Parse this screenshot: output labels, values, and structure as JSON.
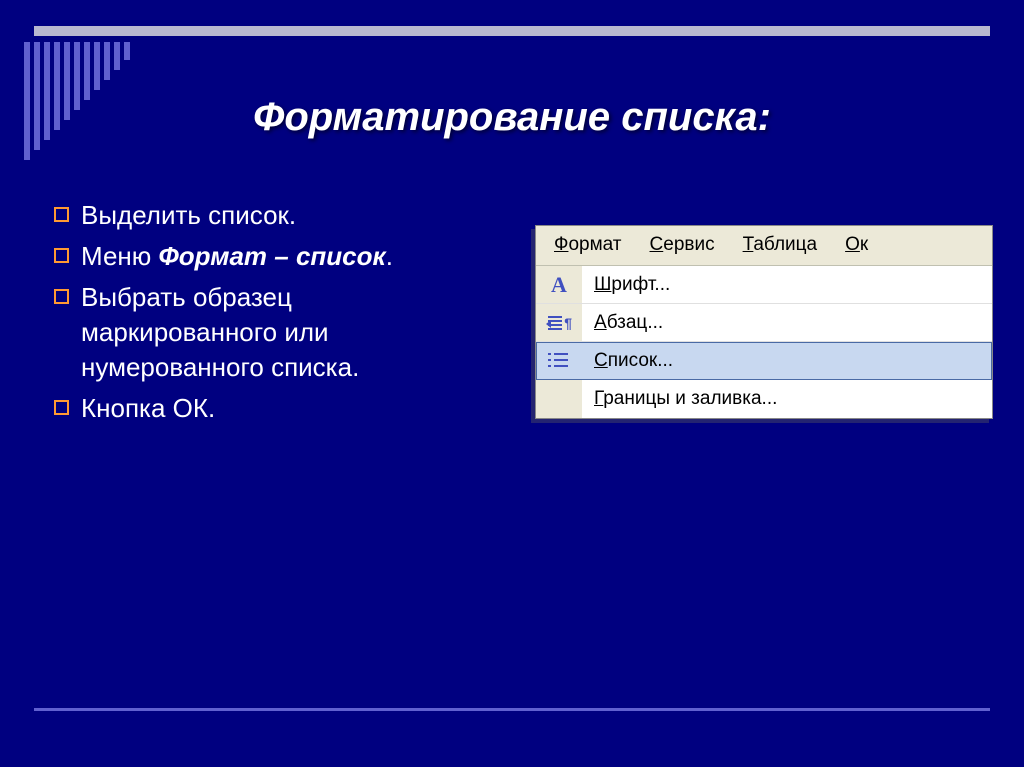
{
  "slide": {
    "title": "Форматирование списка:",
    "bullets": [
      {
        "pre": "Выделить список."
      },
      {
        "pre": "Меню ",
        "em": "Формат – список",
        "post": "."
      },
      {
        "pre": "Выбрать образец маркированного или нумерованного списка."
      },
      {
        "pre": "Кнопка ОК."
      }
    ]
  },
  "menu": {
    "bar": [
      {
        "u": "Ф",
        "rest": "ормат"
      },
      {
        "u": "С",
        "rest": "ервис"
      },
      {
        "u": "Т",
        "rest": "аблица"
      },
      {
        "u": "О",
        "rest": "к"
      }
    ],
    "items": [
      {
        "icon": "font",
        "u": "Ш",
        "rest": "рифт..."
      },
      {
        "icon": "para",
        "u": "А",
        "rest": "бзац..."
      },
      {
        "icon": "list",
        "u": "С",
        "rest": "писок...",
        "highlight": true
      },
      {
        "icon": "",
        "u": "Г",
        "rest": "раницы и заливка..."
      }
    ]
  }
}
